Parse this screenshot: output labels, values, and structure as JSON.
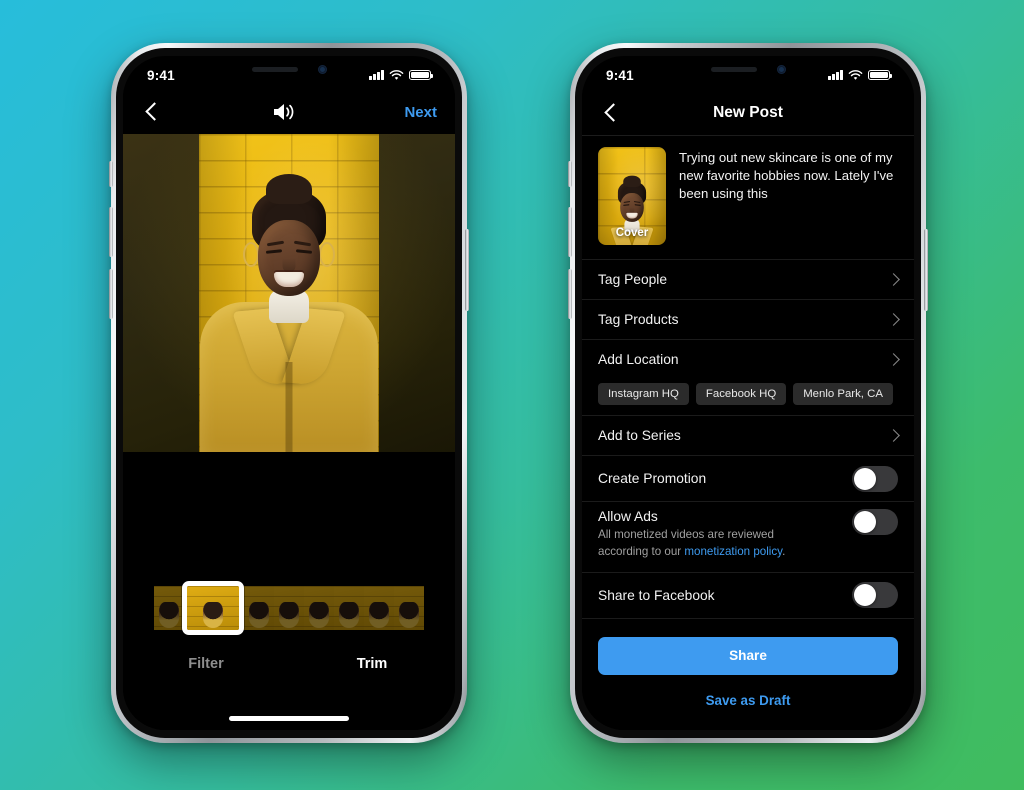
{
  "background": {
    "color_start": "#27BDDB",
    "color_end": "#40BC5E"
  },
  "accent": {
    "blue": "#3E9BF0",
    "chip_bg": "#2B2B2B",
    "toggle_off": "#39393B"
  },
  "left_phone": {
    "status_bar": {
      "time": "9:41",
      "signal_icon": "signal-bars-icon",
      "wifi_icon": "wifi-icon",
      "battery_icon": "battery-icon"
    },
    "nav": {
      "back_icon": "chevron-left-icon",
      "sound_icon": "speaker-volume-icon",
      "next_label": "Next"
    },
    "editor": {
      "media_type": "video-preview",
      "trim_frames": 9,
      "selected_frame_index": 1
    },
    "tabs": [
      {
        "label": "Filter",
        "active": false
      },
      {
        "label": "Trim",
        "active": true
      }
    ],
    "home_indicator": true
  },
  "right_phone": {
    "status_bar": {
      "time": "9:41",
      "signal_icon": "signal-bars-icon",
      "wifi_icon": "wifi-icon",
      "battery_icon": "battery-icon"
    },
    "nav": {
      "back_icon": "chevron-left-icon",
      "title": "New Post"
    },
    "composer": {
      "cover_label": "Cover",
      "caption": "Trying out new skincare is one of my new favorite hobbies now. Lately I've been using this"
    },
    "rows": [
      {
        "label": "Tag People",
        "type": "disclosure"
      },
      {
        "label": "Tag Products",
        "type": "disclosure"
      },
      {
        "label": "Add Location",
        "type": "disclosure"
      },
      {
        "label": "Add to Series",
        "type": "disclosure"
      }
    ],
    "location_chips": [
      {
        "label": "Instagram HQ"
      },
      {
        "label": "Facebook HQ"
      },
      {
        "label": "Menlo Park, CA"
      }
    ],
    "toggles": [
      {
        "label": "Create Promotion",
        "on": false
      },
      {
        "label": "Allow Ads",
        "on": false
      },
      {
        "label": "Share to Facebook",
        "on": false
      }
    ],
    "allow_ads_note": {
      "line1": "All monetized videos are reviewed",
      "line2_prefix": "according to our ",
      "link": "monetization policy",
      "line2_suffix": "."
    },
    "actions": {
      "share_label": "Share",
      "draft_label": "Save as Draft"
    }
  }
}
